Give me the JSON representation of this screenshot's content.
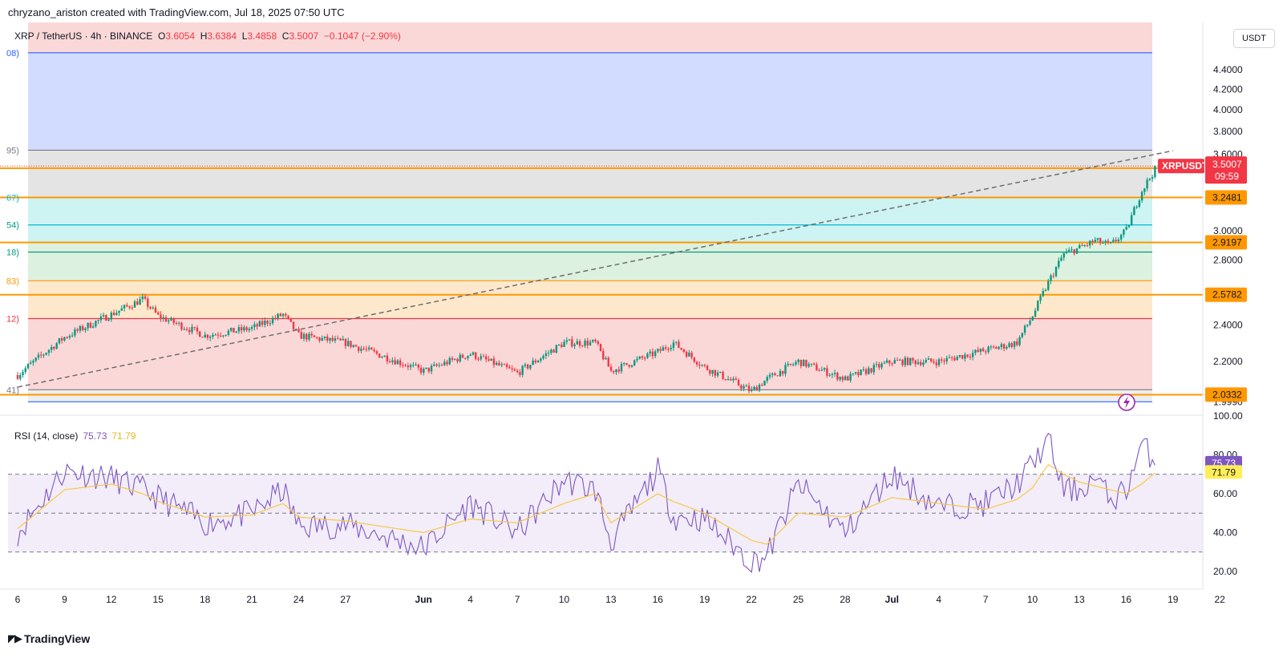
{
  "header": {
    "attribution": "chryzano_ariston created with TradingView.com, Jul 18, 2025 07:50 UTC"
  },
  "legend": {
    "symbol": "XRP / TetherUS · 4h · BINANCE",
    "open_label": "O",
    "open": "3.6054",
    "high_label": "H",
    "high": "3.6384",
    "low_label": "L",
    "low": "3.4858",
    "close_label": "C",
    "close": "3.5007",
    "change": "−0.1047 (−2.90%)"
  },
  "currency_button": "USDT",
  "rsi": {
    "label": "RSI (14, close)",
    "value": "75.73",
    "ma_value": "71.79",
    "axis_labels": [
      "100.00",
      "80.00",
      "60.00",
      "40.00",
      "20.00"
    ],
    "upper_band": 70,
    "middle_band": 50,
    "lower_band": 30
  },
  "price_axis": {
    "labels": [
      "4.4000",
      "4.2000",
      "4.0000",
      "3.8000",
      "3.6000",
      "3.0000",
      "2.8000",
      "2.4000",
      "2.2000"
    ],
    "clipped_label": "1.9990",
    "tags": [
      {
        "text": "3.4827",
        "color": "#ff9800"
      },
      {
        "text": "3.2481",
        "color": "#ff9800"
      },
      {
        "text": "2.9197",
        "color": "#ff9800"
      },
      {
        "text": "2.5782",
        "color": "#ff9800"
      },
      {
        "text": "2.0332",
        "color": "#ff9800"
      }
    ],
    "last_price": {
      "symbol": "XRPUSDT",
      "price": "3.5007",
      "countdown": "09:59",
      "color": "#f23645"
    }
  },
  "fib_left_labels": [
    "08)",
    "95)",
    "67)",
    "54)",
    "18)",
    "83)",
    "12)",
    "41)"
  ],
  "time_axis": {
    "labels": [
      "6",
      "9",
      "12",
      "15",
      "18",
      "21",
      "24",
      "27",
      "Jun",
      "4",
      "7",
      "10",
      "13",
      "16",
      "19",
      "22",
      "25",
      "28",
      "Jul",
      "4",
      "7",
      "10",
      "13",
      "16",
      "19",
      "22"
    ]
  },
  "chart_data": {
    "type": "line",
    "description_of_series": "XRP/USDT 4h price path (approx. close) and RSI(14) with its moving average",
    "x": [
      "May 6",
      "May 9",
      "May 12",
      "May 14",
      "May 15",
      "May 18",
      "May 21",
      "May 23",
      "May 24",
      "May 27",
      "Jun 1",
      "Jun 4",
      "Jun 7",
      "Jun 10",
      "Jun 12",
      "Jun 13",
      "Jun 16",
      "Jun 17",
      "Jun 19",
      "Jun 22",
      "Jun 23",
      "Jun 25",
      "Jun 28",
      "Jul 1",
      "Jul 4",
      "Jul 7",
      "Jul 9",
      "Jul 10",
      "Jul 11",
      "Jul 12",
      "Jul 13",
      "Jul 14",
      "Jul 15",
      "Jul 16",
      "Jul 17",
      "Jul 18"
    ],
    "series": [
      {
        "name": "XRPUSDT",
        "values": [
          2.13,
          2.33,
          2.46,
          2.55,
          2.45,
          2.34,
          2.38,
          2.46,
          2.34,
          2.3,
          2.15,
          2.24,
          2.14,
          2.3,
          2.3,
          2.15,
          2.25,
          2.3,
          2.17,
          2.05,
          2.11,
          2.2,
          2.11,
          2.2,
          2.2,
          2.26,
          2.3,
          2.45,
          2.65,
          2.84,
          2.88,
          2.93,
          2.9,
          3.0,
          3.3,
          3.5007
        ]
      },
      {
        "name": "RSI",
        "values": [
          40,
          72,
          68,
          62,
          58,
          45,
          50,
          62,
          43,
          44,
          32,
          55,
          40,
          67,
          62,
          35,
          72,
          48,
          47,
          25,
          28,
          65,
          40,
          70,
          53,
          55,
          65,
          75,
          88,
          62,
          62,
          68,
          57,
          62,
          85,
          75.73
        ]
      },
      {
        "name": "RSI-based MA",
        "values": [
          42,
          62,
          65,
          60,
          56,
          48,
          49,
          55,
          48,
          46,
          40,
          47,
          45,
          55,
          60,
          45,
          60,
          56,
          50,
          36,
          34,
          50,
          48,
          58,
          55,
          52,
          57,
          63,
          75,
          70,
          66,
          64,
          62,
          60,
          65,
          71.79
        ]
      }
    ],
    "fib_levels": [
      4.581,
      3.634,
      3.482,
      3.248,
      3.043,
      2.919,
      2.853,
      2.665,
      2.578,
      2.436,
      2.057,
      2.033,
      1.999
    ],
    "trendline": {
      "from": [
        "May 6",
        2.07
      ],
      "to": [
        "Jul 19",
        3.63
      ]
    },
    "ylim": [
      1.99,
      4.7
    ],
    "rsi_ylim": [
      10,
      100
    ]
  }
}
